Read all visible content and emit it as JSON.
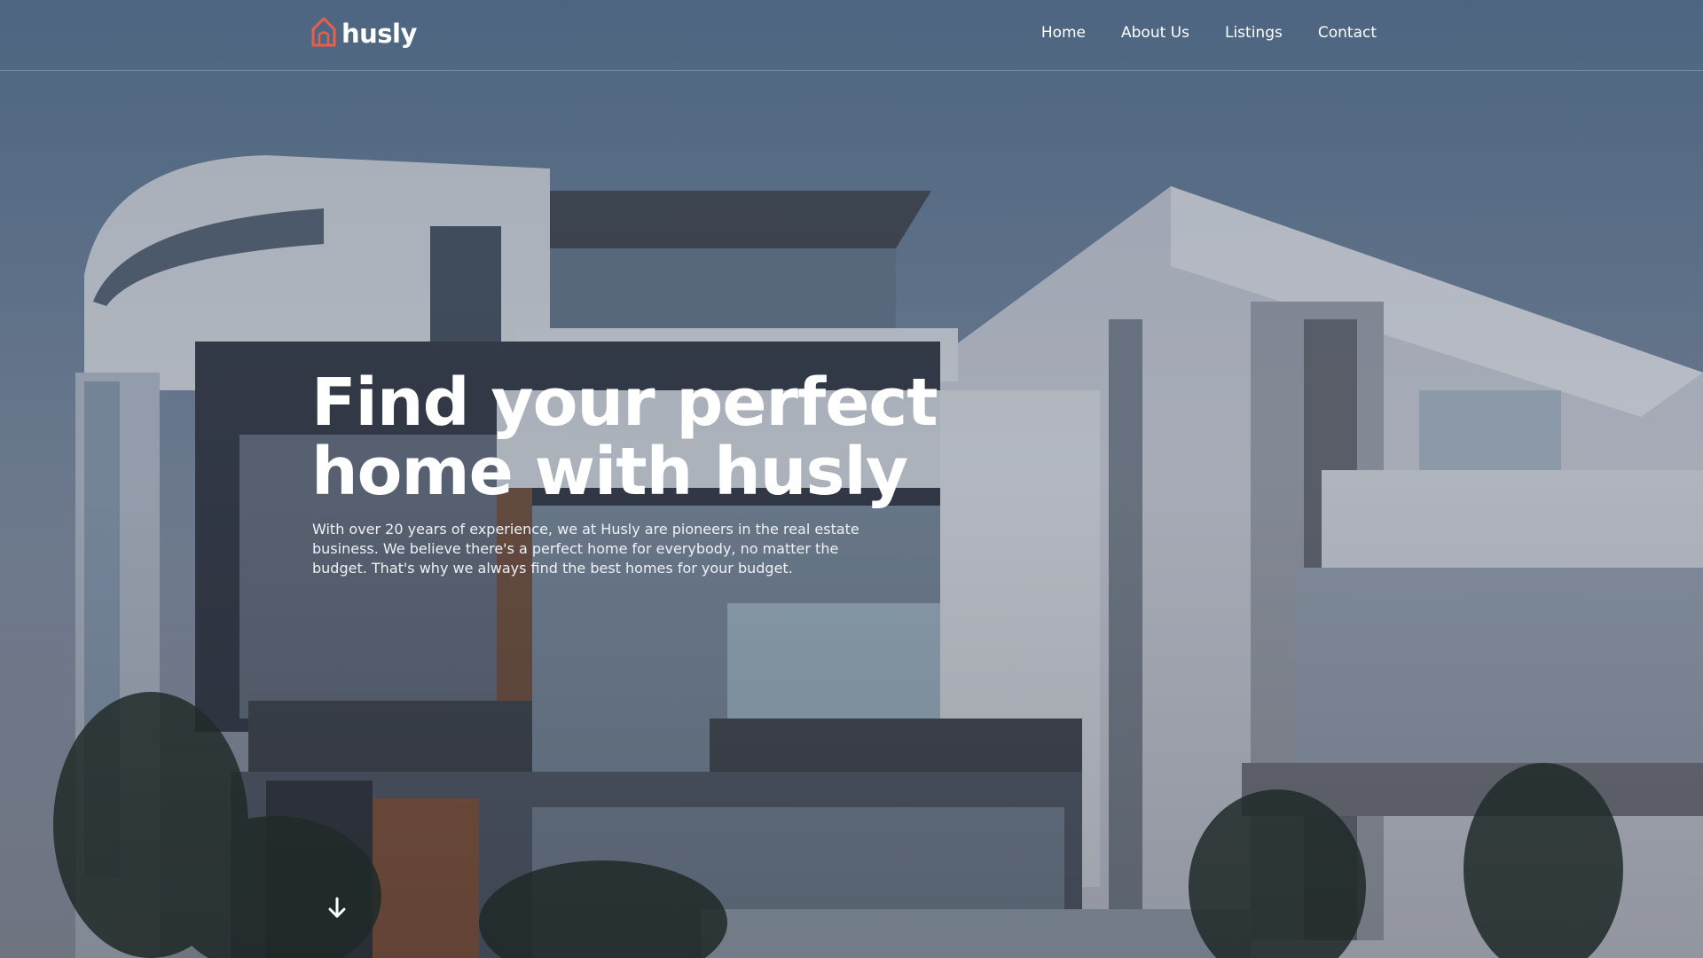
{
  "brand": {
    "name": "husly",
    "logo_icon": "house-outline-icon",
    "accent_color": "#e8604c"
  },
  "nav": {
    "items": [
      "Home",
      "About Us",
      "Listings",
      "Contact"
    ]
  },
  "hero": {
    "headline": "Find your perfect home with husly",
    "description": "With over 20 years of experience, we at Husly are pioneers in the real estate business. We believe there's a perfect home for everybody, no matter the budget. That's why we always find the best homes for your budget.",
    "scroll_icon": "arrow-down-icon",
    "background_image": "modern-white-house-photo"
  }
}
